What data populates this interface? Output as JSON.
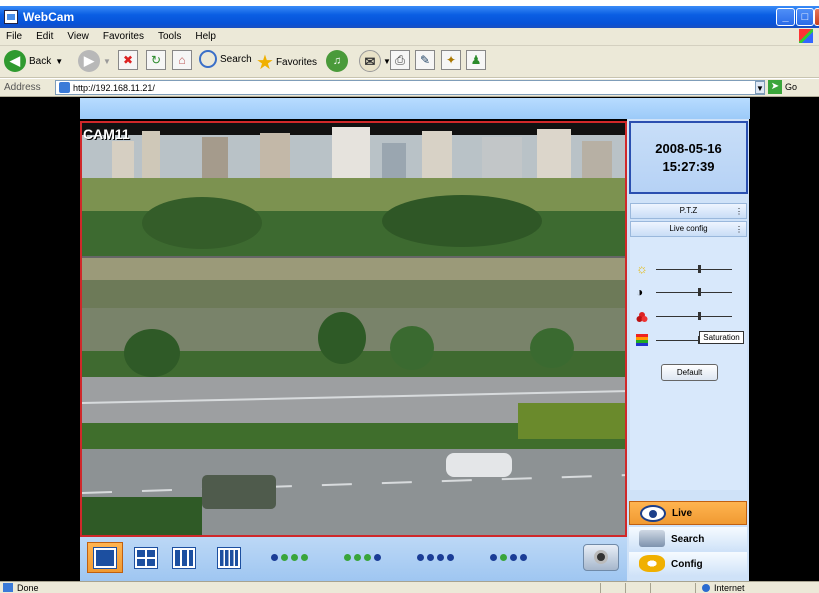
{
  "window": {
    "title": "WebCam",
    "buttons": [
      "_",
      "□",
      "✕"
    ]
  },
  "menu": [
    "File",
    "Edit",
    "View",
    "Favorites",
    "Tools",
    "Help"
  ],
  "toolbar": {
    "back_label": "Back",
    "search_label": "Search",
    "favorites_label": "Favorites"
  },
  "address": {
    "label": "Address",
    "url": "http://192.168.11.21/",
    "go_label": "Go"
  },
  "camera": {
    "label": "CAM11"
  },
  "clock": {
    "date": "2008-05-16",
    "time": "15:27:39"
  },
  "tabs": [
    {
      "label": "P.T.Z"
    },
    {
      "label": "Live config"
    }
  ],
  "sliders": [
    {
      "icon": "brightness-icon",
      "level": 0.55
    },
    {
      "icon": "contrast-icon",
      "level": 0.55
    },
    {
      "icon": "hue-icon",
      "level": 0.55
    },
    {
      "icon": "saturation-icon",
      "level": 0.55
    }
  ],
  "tooltip": {
    "text": "Saturation"
  },
  "default_button": {
    "label": "Default"
  },
  "nav": [
    {
      "label": "Live",
      "icon": "eye-icon",
      "active": true
    },
    {
      "label": "Search",
      "icon": "search-icon",
      "active": false
    },
    {
      "label": "Config",
      "icon": "gear-icon",
      "active": false
    }
  ],
  "channel_dots": [
    [
      "#1a3c96",
      "#3aa53a",
      "#3aa53a",
      "#3aa53a"
    ],
    [
      "#3aa53a",
      "#3aa53a",
      "#3aa53a",
      "#1a3c96"
    ],
    [
      "#1a3c96",
      "#1a3c96",
      "#1a3c96",
      "#1a3c96"
    ],
    [
      "#1a3c96",
      "#3aa53a",
      "#1a3c96",
      "#1a3c96"
    ]
  ],
  "status": {
    "left": "Done",
    "zone": "Internet"
  },
  "colors": {
    "accent_orange": "#f09a32",
    "frame_red": "#d0282a",
    "panel_blue": "#cfe2f8"
  }
}
